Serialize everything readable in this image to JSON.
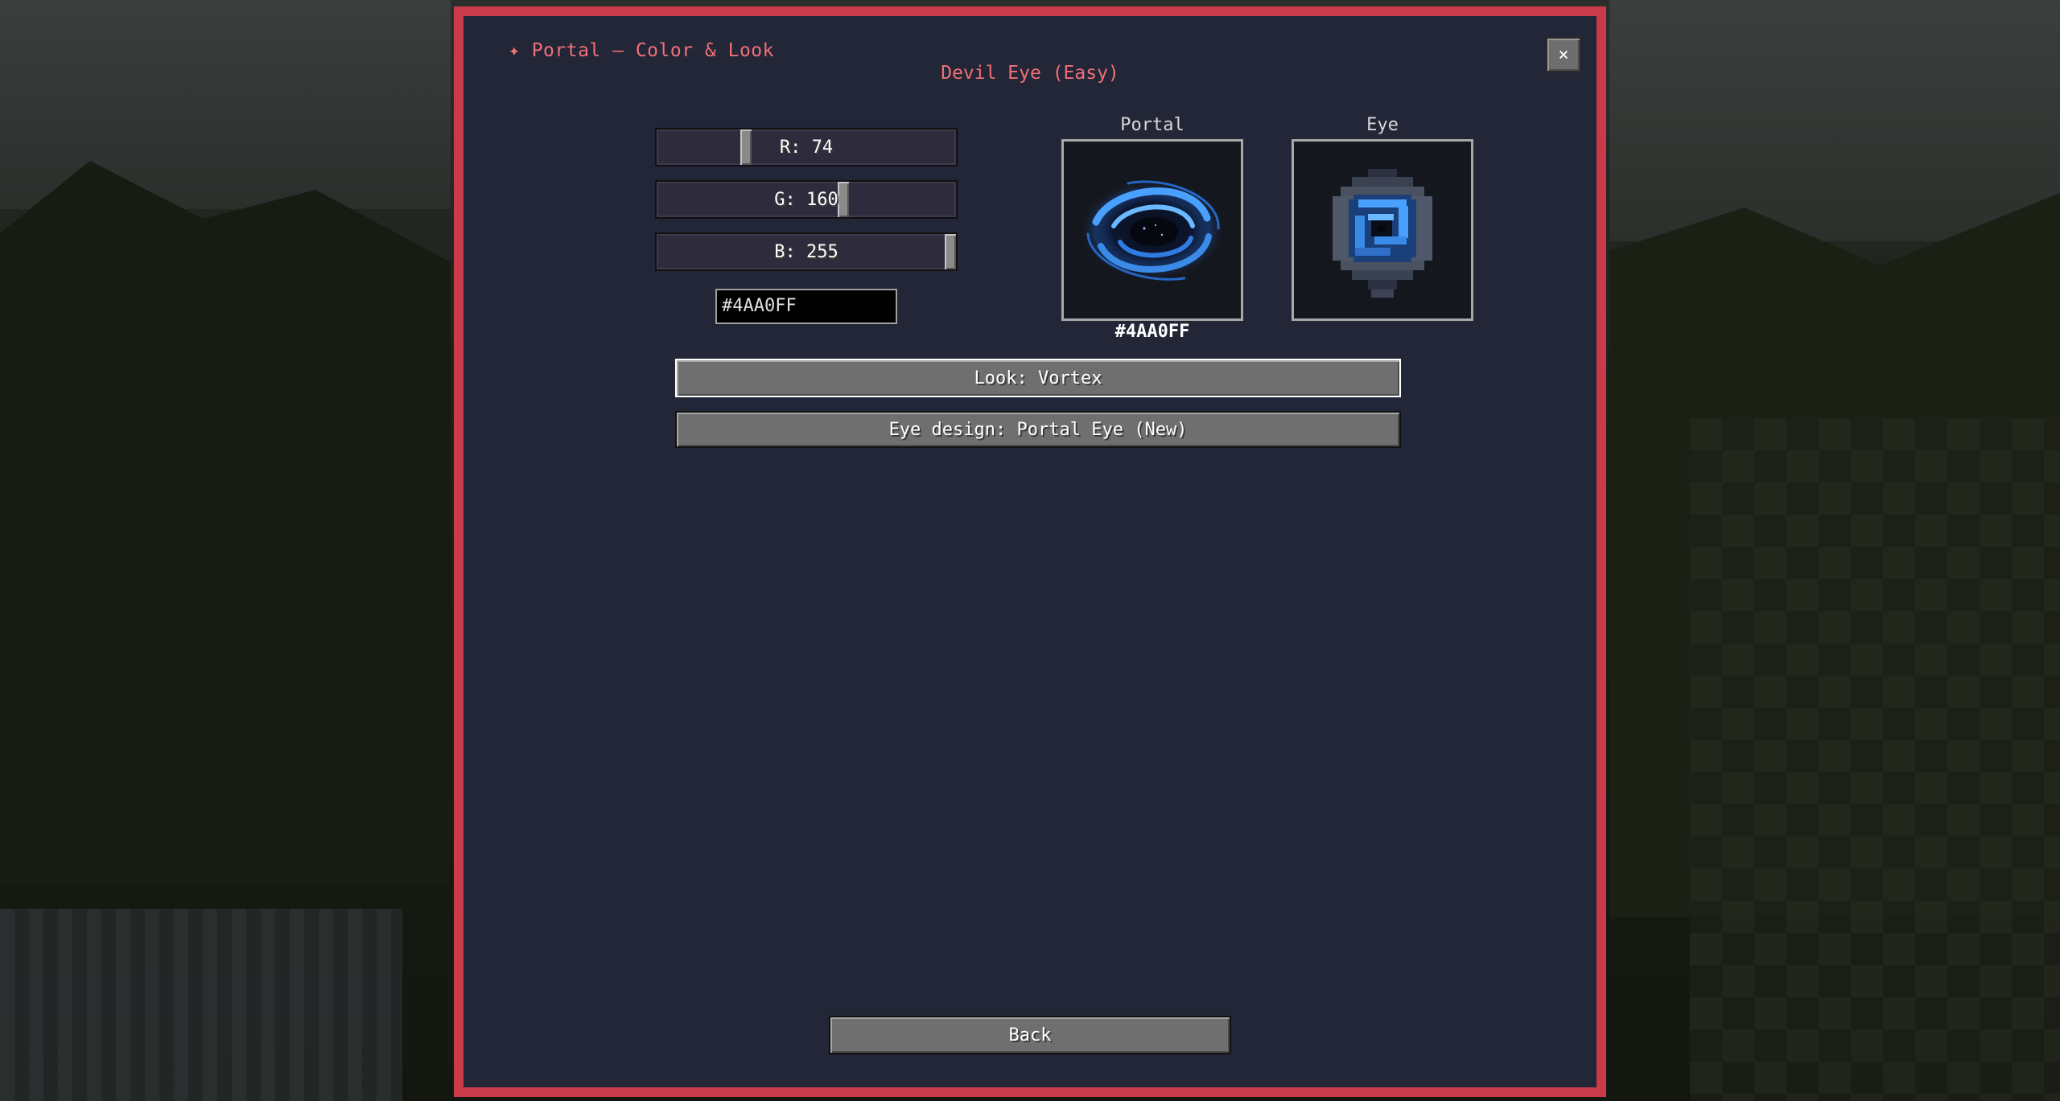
{
  "dialog": {
    "header": "✦ Portal — Color & Look",
    "subtitle": "Devil Eye (Easy)",
    "close_label": "×"
  },
  "color": {
    "r_label": "R: 74",
    "g_label": "G: 160",
    "b_label": "B: 255",
    "r_value": 74,
    "g_value": 160,
    "b_value": 255,
    "hex_value": "#4AA0FF"
  },
  "preview": {
    "portal_label": "Portal",
    "eye_label": "Eye",
    "hex_caption": "#4AA0FF"
  },
  "buttons": {
    "look": "Look: Vortex",
    "eye_design": "Eye design: Portal Eye (New)",
    "back": "Back"
  },
  "colors": {
    "accent_border": "#c93a4a",
    "title_text": "#f07078",
    "panel_bg": "#222636",
    "portal_color": "#4AA0FF"
  }
}
